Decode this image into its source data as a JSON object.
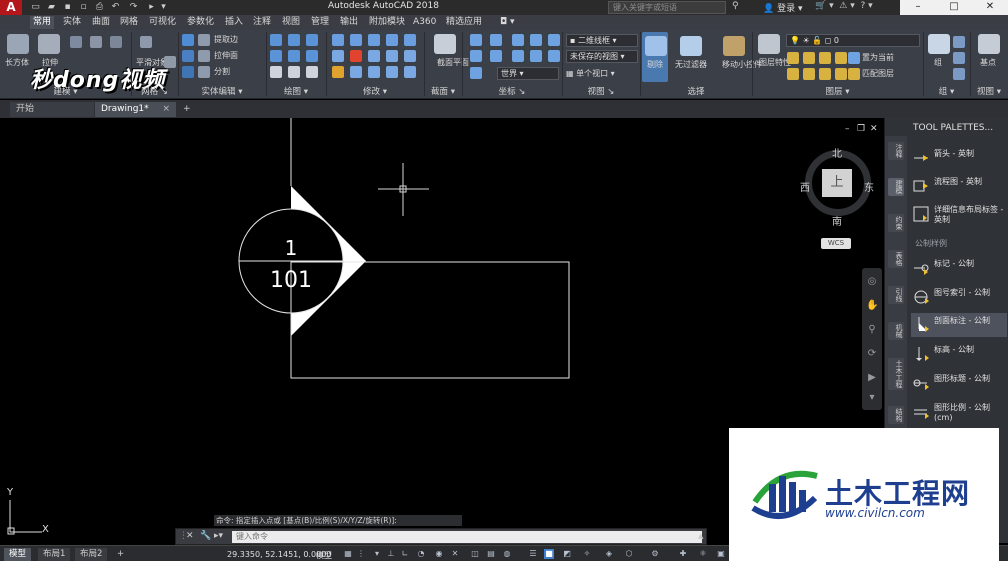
{
  "app": {
    "logo": "A",
    "title": "Autodesk AutoCAD 2018"
  },
  "titlebar": {
    "search_placeholder": "键入关键字或短语",
    "login": "登录",
    "help": "?"
  },
  "window_buttons": {
    "minimize": "–",
    "maximize": "□",
    "close": "✕"
  },
  "watermark_logo": "秒dong视频",
  "ribbon_tabs": [
    "常用",
    "实体",
    "曲面",
    "网格",
    "可视化",
    "参数化",
    "插入",
    "注释",
    "视图",
    "管理",
    "输出",
    "附加模块",
    "A360",
    "精选应用"
  ],
  "ribbon": {
    "model": {
      "title": "建模",
      "box": "长方体",
      "extrude": "拉伸",
      "smooth": "平滑对象"
    },
    "mesh": {
      "title": "网格"
    },
    "solid_edit": {
      "title": "实体编辑",
      "extract_edges": "提取边",
      "extrude_face": "拉伸面",
      "slice": "分割"
    },
    "draw": {
      "title": "绘图"
    },
    "modify": {
      "title": "修改"
    },
    "section": {
      "title": "截面",
      "plane": "截面平面"
    },
    "coords": {
      "title": "坐标",
      "world": "世界"
    },
    "view": {
      "title": "视图",
      "visual_style": "二维线框",
      "saved_view": "未保存的视图",
      "viewport": "单个视口"
    },
    "select": {
      "title": "选择",
      "cull": "剔除",
      "no_filter": "无过滤器",
      "gizmo": "移动小控件"
    },
    "layers": {
      "title": "图层",
      "layer_props": "图层特性",
      "layer_name": "0",
      "set_current": "置为当前",
      "match_layer": "匹配图层"
    },
    "group": {
      "title": "组",
      "group": "组"
    },
    "view2": {
      "title": "视图",
      "base": "基点"
    }
  },
  "file_tabs": {
    "start": "开始",
    "drawing": "Drawing1*",
    "close": "×",
    "add": "+"
  },
  "viewport_controls": [
    "–",
    "❐",
    "✕"
  ],
  "viewcube": {
    "north": "北",
    "south": "南",
    "west": "西",
    "east": "东",
    "top": "上",
    "wcs": "WCS"
  },
  "drawing": {
    "top_number": "1",
    "bottom_number": "101"
  },
  "tool_palettes": {
    "title": "TOOL PALETTES...",
    "vertical_tabs": [
      "注释",
      "建模",
      "约束",
      "表格",
      "引线",
      "机械",
      "土木工程",
      "结构",
      "命令"
    ],
    "items_top": [
      "箭头 - 英制",
      "流程图 - 英制",
      "详细信息布局标签 - 英制"
    ],
    "section_label": "公制样例",
    "items_bottom": [
      "标记 - 公制",
      "图号索引 - 公制",
      "剖面标注 - 公制",
      "标高 - 公制",
      "图形标题 - 公制",
      "图形比例 - 公制 (cm)"
    ]
  },
  "command": {
    "history": "命令: 指定插入点或 [基点(B)/比例(S)/X/Y/Z/旋转(R)]:",
    "placeholder": "键入命令"
  },
  "ucs": {
    "x": "X",
    "y": "Y"
  },
  "statusbar": {
    "tabs": [
      "模型",
      "布局1",
      "布局2"
    ],
    "add": "+",
    "coords": "29.3350, 52.1451, 0.0000",
    "model_label": "模型"
  },
  "watermark": {
    "title": "土木工程网",
    "url": "www.civilcn.com"
  },
  "colors": {
    "ribbon_bg": "#3b3f47",
    "canvas_bg": "#000000",
    "accent_red": "#b3161b",
    "watermark_blue": "#1e3f8f"
  }
}
